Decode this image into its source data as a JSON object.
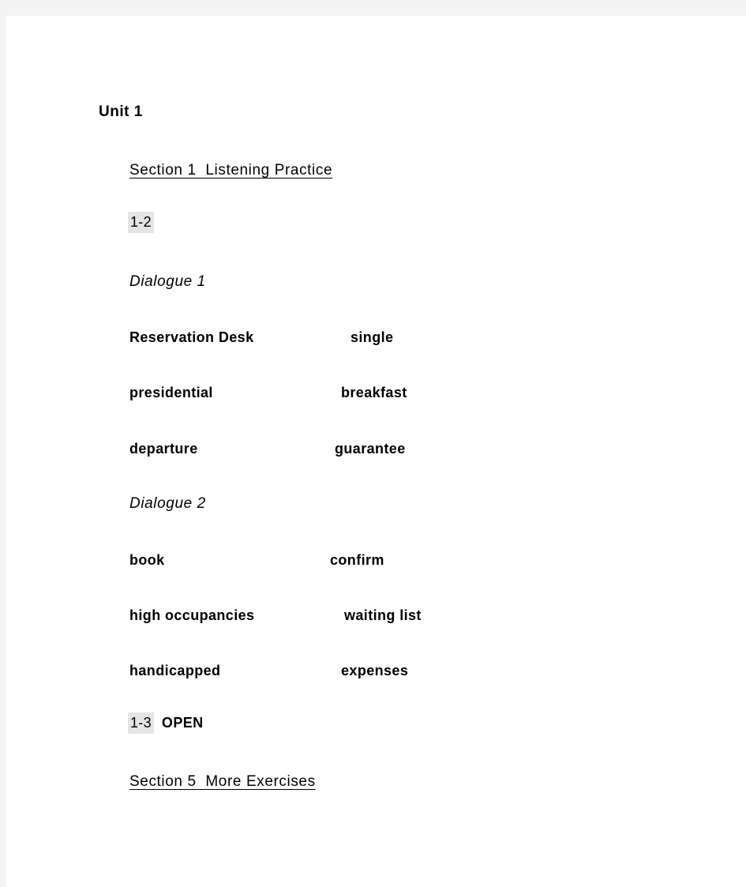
{
  "document": {
    "title": "Unit 1",
    "sections": [
      {
        "heading": "Section 1  Listening Practice",
        "tracks": [
          {
            "id": "1-2",
            "label": ""
          }
        ],
        "dialogues": [
          {
            "label": "Dialogue 1",
            "rows": [
              {
                "left": "Reservation Desk",
                "right": "single"
              },
              {
                "left": "presidential",
                "right": "breakfast"
              },
              {
                "left": "departure",
                "right": "guarantee"
              }
            ]
          },
          {
            "label": "Dialogue 2",
            "rows": [
              {
                "left": "book",
                "right": "confirm"
              },
              {
                "left": "high occupancies",
                "right": "waiting list"
              },
              {
                "left": "handicapped",
                "right": "expenses"
              }
            ]
          }
        ],
        "open_track": {
          "id": "1-3",
          "label": "OPEN"
        }
      },
      {
        "heading": "Section 5  More Exercises"
      }
    ]
  },
  "colors": {
    "page_background": "#ffffff",
    "canvas_background": "#f4f4f4",
    "highlight": "#e4e4e4",
    "text": "#000000"
  }
}
